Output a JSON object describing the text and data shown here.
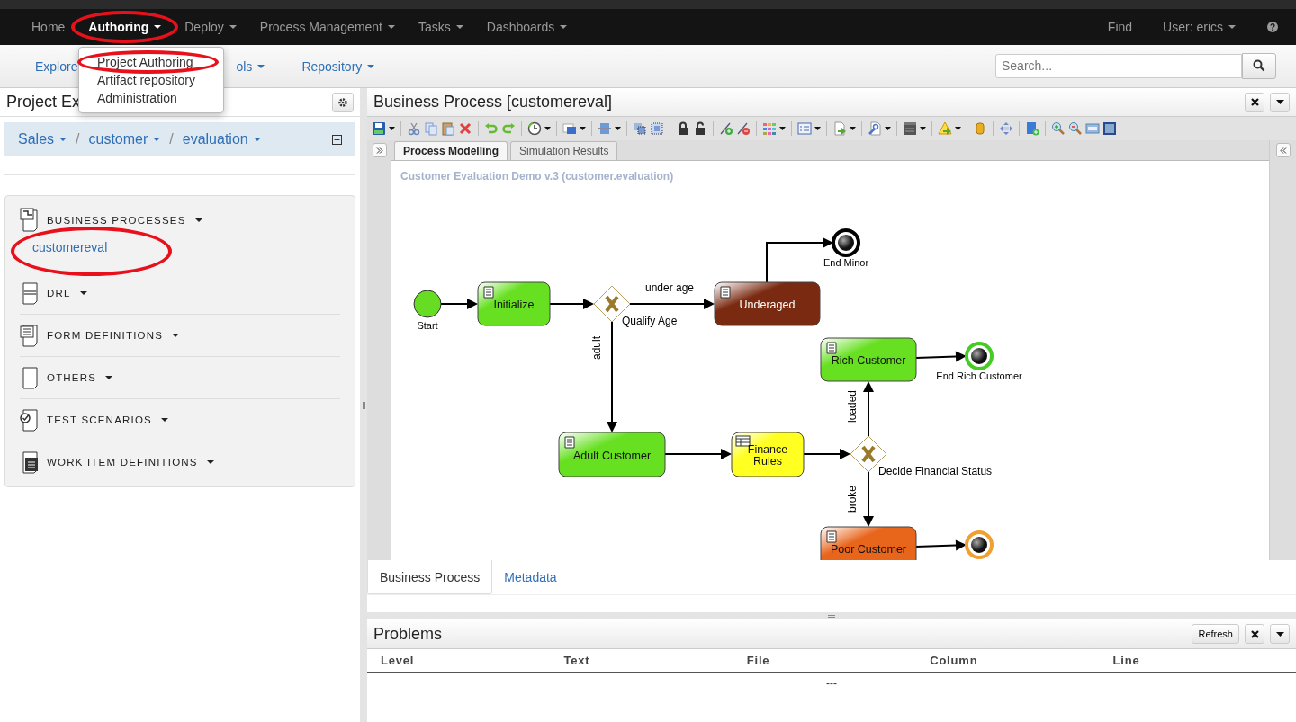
{
  "nav": {
    "items": [
      {
        "label": "Home",
        "dropdown": false,
        "selected": false,
        "circled": false
      },
      {
        "label": "Authoring",
        "dropdown": true,
        "selected": true,
        "circled": true
      },
      {
        "label": "Deploy",
        "dropdown": true,
        "selected": false,
        "circled": false
      },
      {
        "label": "Process Management",
        "dropdown": true,
        "selected": false,
        "circled": false
      },
      {
        "label": "Tasks",
        "dropdown": true,
        "selected": false,
        "circled": false
      },
      {
        "label": "Dashboards",
        "dropdown": true,
        "selected": false,
        "circled": false
      }
    ],
    "right": [
      {
        "label": "Find",
        "dropdown": false
      },
      {
        "label": "User: erics",
        "dropdown": true
      }
    ],
    "help": "?"
  },
  "authoring_menu": {
    "items": [
      {
        "label": "Project Authoring",
        "circled": true
      },
      {
        "label": "Artifact repository",
        "circled": false
      },
      {
        "label": "Administration",
        "circled": false
      }
    ]
  },
  "subnav": {
    "items": [
      {
        "label": "Explore",
        "dropdown": false
      },
      {
        "label": "ols",
        "dropdown": true
      },
      {
        "label": "Repository",
        "dropdown": true
      }
    ]
  },
  "search": {
    "placeholder": "Search..."
  },
  "explorer": {
    "title": "Project Ex",
    "breadcrumb": [
      "Sales",
      "customer",
      "evaluation"
    ],
    "separators": [
      "/",
      "/"
    ],
    "sections": [
      {
        "label": "BUSINESS PROCESSES",
        "assets": [
          {
            "label": "customereval",
            "circled": true
          }
        ]
      },
      {
        "label": "DRL"
      },
      {
        "label": "FORM DEFINITIONS"
      },
      {
        "label": "OTHERS"
      },
      {
        "label": "TEST SCENARIOS"
      },
      {
        "label": "WORK ITEM DEFINITIONS"
      }
    ]
  },
  "editor": {
    "title": "Business Process [customereval]",
    "tabs": [
      {
        "label": "Process Modelling",
        "selected": true
      },
      {
        "label": "Simulation Results",
        "selected": false
      }
    ],
    "process_title": "Customer Evaluation Demo v.3 (customer.evaluation)",
    "nodes": [
      {
        "kind": "start",
        "label": "Start",
        "color": "#66dd22"
      },
      {
        "kind": "script_task",
        "label": "Initialize",
        "color": "#66e020"
      },
      {
        "kind": "gateway",
        "label": "Qualify Age"
      },
      {
        "kind": "script_task",
        "label": "Underaged",
        "color": "#7a2a10"
      },
      {
        "kind": "end",
        "label": "End Minor",
        "color": "#000000"
      },
      {
        "kind": "script_task",
        "label": "Adult Customer",
        "color": "#66e020"
      },
      {
        "kind": "rule_task",
        "label": "Finance Rules",
        "color": "#ffff22"
      },
      {
        "kind": "script_task",
        "label": "Rich Customer",
        "color": "#66e020"
      },
      {
        "kind": "gateway",
        "label": "Decide Financial Status"
      },
      {
        "kind": "end",
        "label": "End Rich Customer",
        "color": "#44cc22"
      },
      {
        "kind": "script_task",
        "label": "Poor Customer",
        "color": "#e8651c"
      },
      {
        "kind": "end",
        "color": "#f0a030"
      }
    ],
    "edge_labels": [
      "under age",
      "adult",
      "loaded",
      "broke"
    ],
    "bottom_tabs": [
      {
        "label": "Business Process",
        "selected": true
      },
      {
        "label": "Metadata",
        "selected": false
      }
    ]
  },
  "problems": {
    "title": "Problems",
    "refresh": "Refresh",
    "columns": [
      "Level",
      "Text",
      "File",
      "Column",
      "Line"
    ],
    "empty_message": "---"
  }
}
